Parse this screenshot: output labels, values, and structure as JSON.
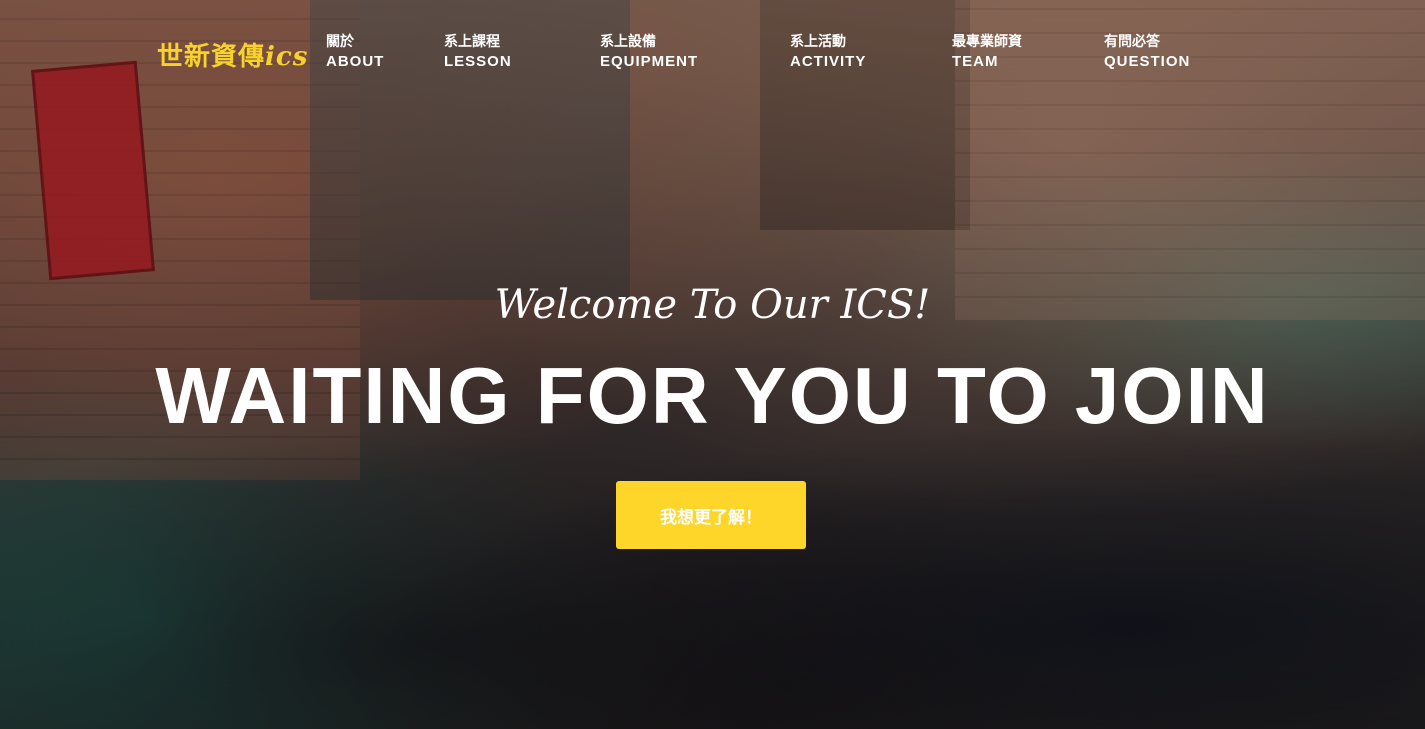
{
  "brand": {
    "logo_main": "世新資傳",
    "logo_suffix": "ics",
    "color": "#f7d22a"
  },
  "nav": {
    "items": [
      {
        "zh": "關於",
        "en": "ABOUT"
      },
      {
        "zh": "系上課程",
        "en": "LESSON"
      },
      {
        "zh": "系上設備",
        "en": "EQUIPMENT"
      },
      {
        "zh": "系上活動",
        "en": "ACTIVITY"
      },
      {
        "zh": "最專業師資",
        "en": "TEAM"
      },
      {
        "zh": "有問必答",
        "en": "QUESTION"
      }
    ]
  },
  "hero": {
    "welcome": "Welcome To Our ICS!",
    "headline": "WAITING FOR YOU TO JOIN",
    "cta_label": "我想更了解！",
    "cta_color": "#fed629"
  }
}
